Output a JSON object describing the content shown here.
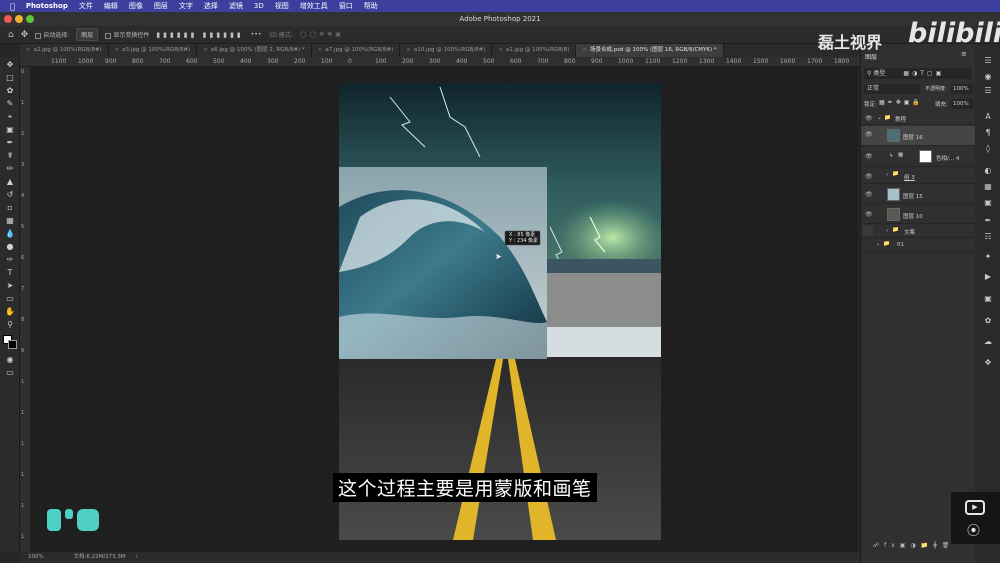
{
  "mac_menu": {
    "app": "Photoshop",
    "items": [
      "文件",
      "编辑",
      "图像",
      "图层",
      "文字",
      "选择",
      "滤镜",
      "3D",
      "视图",
      "增效工具",
      "窗口",
      "帮助"
    ]
  },
  "window_title": "Adobe Photoshop 2021",
  "options_bar": {
    "auto_select_label": "自动选择:",
    "auto_select_value": "图层",
    "show_transform": "显示变换控件",
    "mode_3d": "3D 模式:"
  },
  "tabs": [
    "a2.jpg @ 100%(RGB/8#)",
    "a3.jpg @ 100%(RGB/8#)",
    "a6.jpg @ 100% (图层 2, RGB/8#) *",
    "a7.jpg @ 100%(RGB/8#)",
    "a10.jpg @ 100%(RGB/8#)",
    "a1.jpg @ 100%(RGB/8)",
    "场景合成.psd @ 100% (图层 16, RGB/8/CMYK) *"
  ],
  "ruler_labels": [
    "1100",
    "1000",
    "900",
    "800",
    "700",
    "600",
    "500",
    "400",
    "300",
    "200",
    "100",
    "0",
    "100",
    "200",
    "300",
    "400",
    "500",
    "600",
    "700",
    "800",
    "900",
    "1000",
    "1100",
    "1200",
    "1300",
    "1400",
    "1500",
    "1600",
    "1700",
    "1800",
    "1900"
  ],
  "vruler_labels": [
    "0",
    "1",
    "2",
    "3",
    "4",
    "5",
    "6",
    "7",
    "8",
    "9",
    "1",
    "1",
    "1",
    "1",
    "1",
    "1"
  ],
  "transform_tooltip": {
    "x": "X : 85 像素",
    "y": "Y : 234 像素"
  },
  "layers_panel": {
    "title": "图层",
    "filter": "类型",
    "blend_mode": "正常",
    "opacity_label": "不透明度:",
    "opacity_value": "100%",
    "lock_label": "锁定:",
    "fill_label": "填充:",
    "fill_value": "100%",
    "layers": [
      {
        "name": "教程",
        "kind": "group-open"
      },
      {
        "name": "图层 16",
        "kind": "layer-selected"
      },
      {
        "name": "色相/... 4",
        "kind": "adjustment"
      },
      {
        "name": "组 3",
        "kind": "group"
      },
      {
        "name": "图层 15",
        "kind": "layer"
      },
      {
        "name": "图层 10",
        "kind": "layer"
      },
      {
        "name": "文案",
        "kind": "group"
      },
      {
        "name": "01",
        "kind": "group"
      }
    ]
  },
  "status": {
    "zoom": "100%",
    "doc": "文档:6.22M/273.3M"
  },
  "subtitle": "这个过程主要是用蒙版和画笔",
  "watermark": {
    "channel": "磊土视界",
    "logo": "bilibili"
  }
}
